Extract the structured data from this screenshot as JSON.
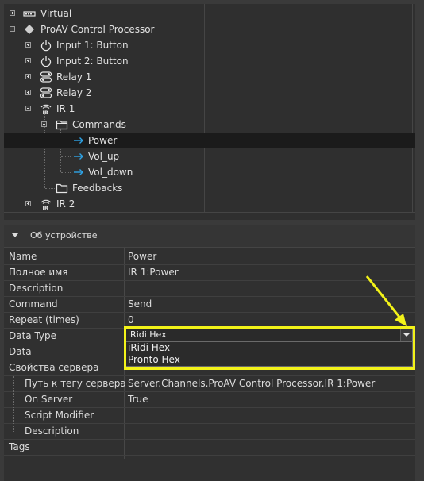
{
  "tree": {
    "items": [
      {
        "label": "Virtual"
      },
      {
        "label": "ProAV Control Processor"
      },
      {
        "label": "Input 1: Button"
      },
      {
        "label": "Input 2: Button"
      },
      {
        "label": "Relay 1"
      },
      {
        "label": "Relay 2"
      },
      {
        "label": "IR 1"
      },
      {
        "label": "Commands"
      },
      {
        "label": "Power"
      },
      {
        "label": "Vol_up"
      },
      {
        "label": "Vol_down"
      },
      {
        "label": "Feedbacks"
      },
      {
        "label": "IR 2"
      }
    ]
  },
  "properties": {
    "section_title": "Об устройстве",
    "rows": [
      {
        "key": "Name",
        "value": "Power"
      },
      {
        "key": "Полное имя",
        "value": "IR 1:Power"
      },
      {
        "key": "Description",
        "value": ""
      },
      {
        "key": "Command",
        "value": "Send"
      },
      {
        "key": "Repeat (times)",
        "value": "0"
      },
      {
        "key": "Data Type",
        "value": "iRidi Hex"
      },
      {
        "key": "Data",
        "value": ""
      },
      {
        "key": "Свойства сервера",
        "value": ""
      },
      {
        "key": "Путь к тегу сервера",
        "value": "Server.Channels.ProAV Control Processor.IR 1:Power"
      },
      {
        "key": "On Server",
        "value": "True"
      },
      {
        "key": "Script Modifier",
        "value": ""
      },
      {
        "key": "Description",
        "value": ""
      },
      {
        "key": "Tags",
        "value": ""
      }
    ],
    "data_type_options": [
      "iRidi Hex",
      "Pronto Hex"
    ]
  },
  "colors": {
    "annotation": "#f2f219",
    "selection": "#1b1b1b",
    "arrow_icon": "#2ea3e6"
  }
}
